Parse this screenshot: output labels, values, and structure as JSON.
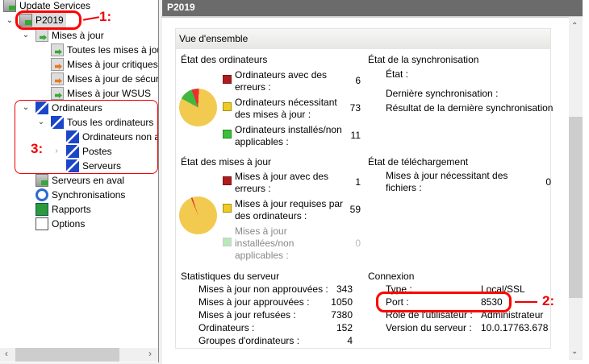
{
  "tree": {
    "root": "Update Services",
    "server": "P2019",
    "updates": "Mises à jour",
    "all_updates": "Toutes les mises à jour",
    "critical": "Mises à jour critiques",
    "security": "Mises à jour de sécurité",
    "wsus": "Mises à jour WSUS",
    "computers": "Ordinateurs",
    "all_computers": "Tous les ordinateurs",
    "unassigned": "Ordinateurs non attribués",
    "postes": "Postes",
    "serveurs": "Serveurs",
    "downstream": "Serveurs en aval",
    "sync": "Synchronisations",
    "reports": "Rapports",
    "options": "Options"
  },
  "header": {
    "title": "P2019"
  },
  "overview": {
    "title": "Vue d'ensemble",
    "computer_status": {
      "title": "État des ordinateurs",
      "items": [
        {
          "label1": "Ordinateurs avec des",
          "label2": "erreurs :",
          "value": "6",
          "color": "#b01c1c"
        },
        {
          "label1": "Ordinateurs nécessitant",
          "label2": "des mises à jour :",
          "value": "73",
          "color": "#f0cc20"
        },
        {
          "label1": "Ordinateurs installés/non",
          "label2": "applicables :",
          "value": "11",
          "color": "#38c038"
        }
      ]
    },
    "sync_status": {
      "title": "État de la synchronisation",
      "state": "État :",
      "last": "Dernière synchronisation :",
      "result": "Résultat de la dernière synchronisation"
    },
    "update_status": {
      "title": "État des mises à jour",
      "items": [
        {
          "label1": "Mises à jour avec des",
          "label2": "erreurs :",
          "value": "1",
          "color": "#b01c1c"
        },
        {
          "label1": "Mises à jour requises par",
          "label2": "des ordinateurs :",
          "value": "59",
          "color": "#f0cc20"
        },
        {
          "label1": "Mises à jour",
          "label2": "installées/non",
          "label3": "applicables :",
          "value": "0",
          "color": "#b8e8b8"
        }
      ]
    },
    "download_status": {
      "title": "État de téléchargement",
      "label1": "Mises à jour nécessitant des",
      "label2": "fichiers :",
      "value": "0"
    },
    "server_stats": {
      "title": "Statistiques du serveur",
      "rows": [
        {
          "label": "Mises à jour non approuvées :",
          "value": "343"
        },
        {
          "label": "Mises à jour approuvées :",
          "value": "1050"
        },
        {
          "label": "Mises à jour refusées :",
          "value": "7380"
        },
        {
          "label": "Ordinateurs :",
          "value": "152"
        },
        {
          "label": "Groupes d'ordinateurs :",
          "value": "4"
        }
      ]
    },
    "connection": {
      "title": "Connexion",
      "rows": [
        {
          "label": "Type :",
          "value": "Local/SSL"
        },
        {
          "label": "Port :",
          "value": "8530"
        },
        {
          "label": "Rôle de l'utilisateur :",
          "value": "Administrateur"
        },
        {
          "label": "Version du serveur :",
          "value": "10.0.17763.678"
        }
      ]
    }
  },
  "annotations": {
    "a1": "1:",
    "a2": "2:",
    "a3": "3:"
  }
}
